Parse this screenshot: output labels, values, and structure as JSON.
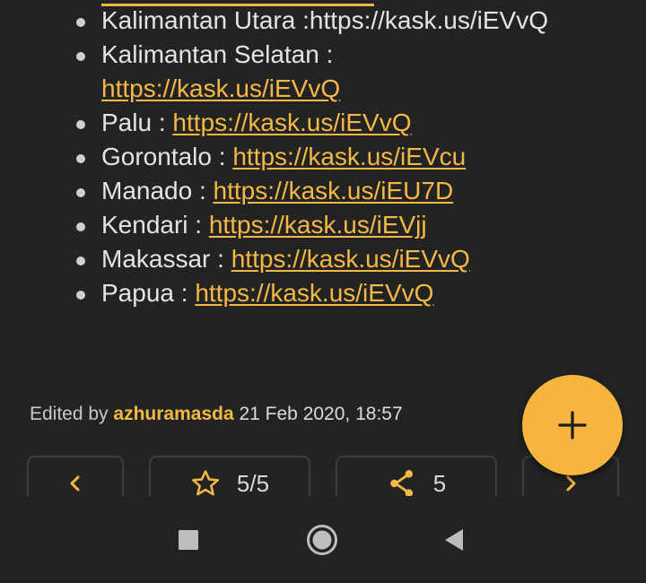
{
  "content": {
    "locations": [
      {
        "name": "Kalimantan Utara :",
        "link": "https://kask.us/iEVvQ",
        "linked": false
      },
      {
        "name": "Kalimantan Selatan :",
        "link": "https://kask.us/iEVvQ",
        "linked": true
      },
      {
        "name": "Palu :",
        "link": "https://kask.us/iEVvQ",
        "linked": true
      },
      {
        "name": "Gorontalo :",
        "link": "https://kask.us/iEVcu",
        "linked": true
      },
      {
        "name": "Manado :",
        "link": "https://kask.us/iEU7D",
        "linked": true
      },
      {
        "name": "Kendari :",
        "link": "https://kask.us/iEVjj",
        "linked": true
      },
      {
        "name": "Makassar :",
        "link": "https://kask.us/iEVvQ",
        "linked": true
      },
      {
        "name": "Papua :",
        "link": "https://kask.us/iEVvQ",
        "linked": true
      }
    ]
  },
  "edit_info": {
    "prefix": "Edited by",
    "user": "azhuramasda",
    "timestamp": "21 Feb 2020, 18:57"
  },
  "fab": {
    "icon": "plus-icon"
  },
  "action_bar": {
    "prev_icon": "chevron-left-icon",
    "rating_icon": "star-outline-icon",
    "rating": "5/5",
    "share_icon": "share-icon",
    "share_count": "5",
    "next_icon": "chevron-right-icon"
  },
  "system_nav": {
    "recents_icon": "square-icon",
    "home_icon": "circle-icon",
    "back_icon": "triangle-back-icon"
  },
  "colors": {
    "accent": "#f4b944",
    "background": "#232323",
    "text": "#e4e4e4"
  }
}
